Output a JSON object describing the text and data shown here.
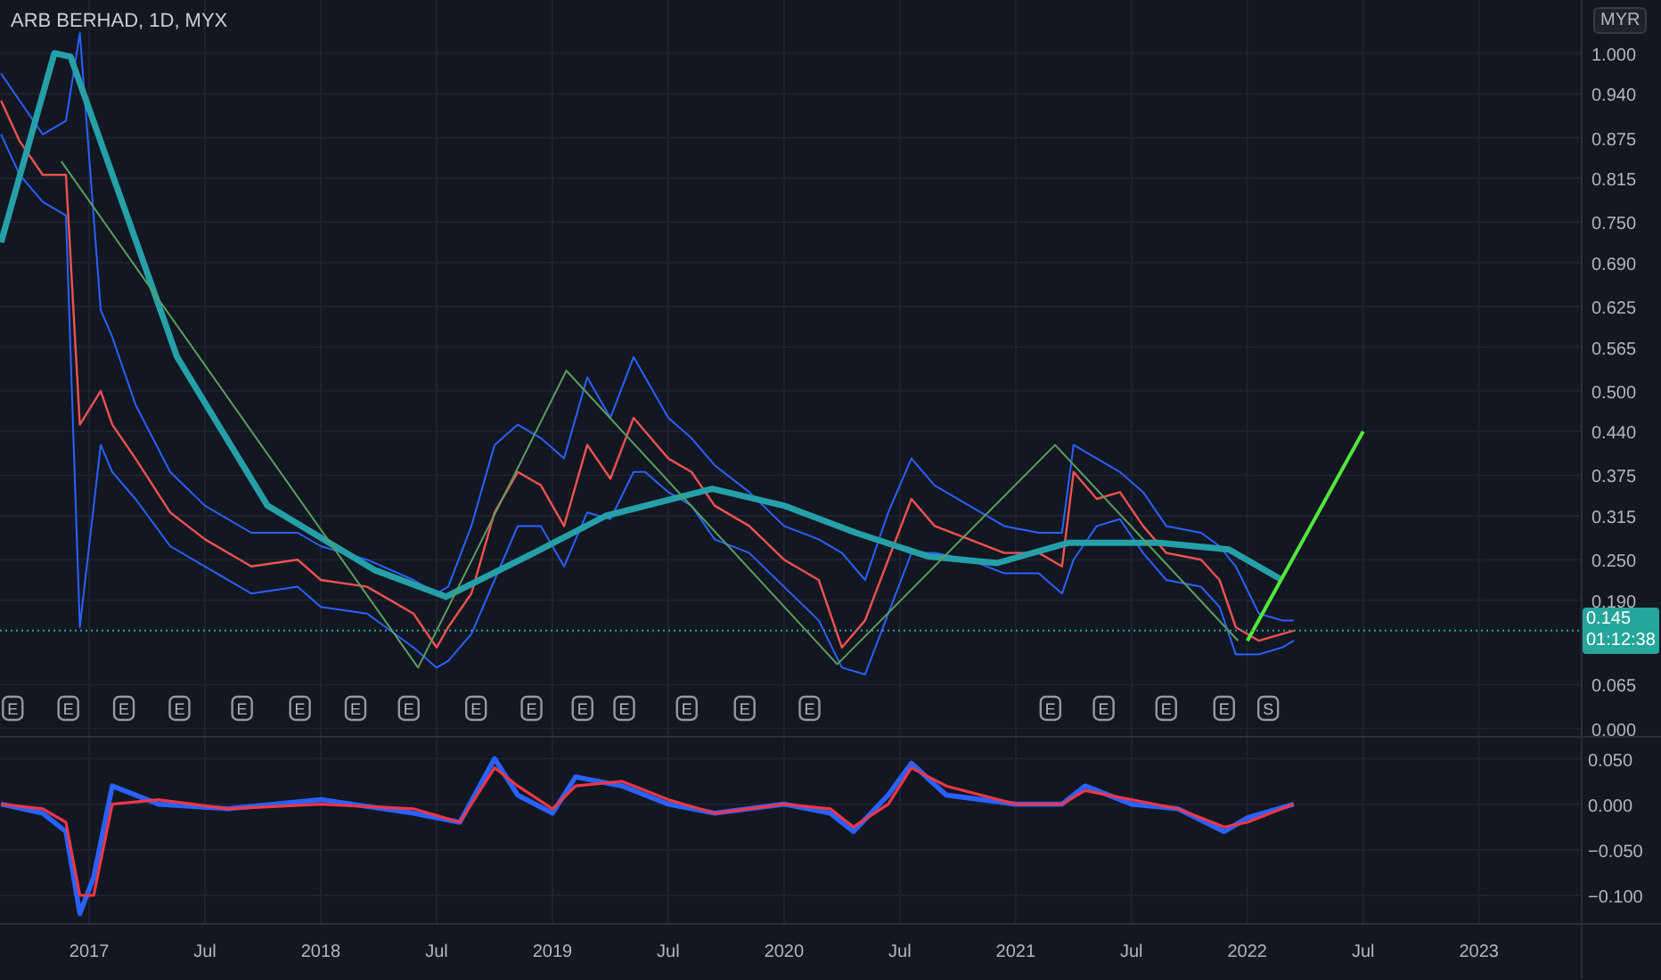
{
  "symbol": {
    "title": "ARB BERHAD, 1D, MYX",
    "currency": "MYR"
  },
  "price_chart": {
    "chart_data": {
      "type": "line",
      "grid": true,
      "xlim": [
        2016.615,
        2023.786
      ],
      "ylim": [
        -0.011,
        1.079
      ],
      "yticks": [
        {
          "value": 0,
          "label": "0.000"
        },
        {
          "value": 0.065,
          "label": "0.065"
        },
        {
          "value": 0.19,
          "label": "0.190"
        },
        {
          "value": 0.25,
          "label": "0.250"
        },
        {
          "value": 0.315,
          "label": "0.315"
        },
        {
          "value": 0.375,
          "label": "0.375"
        },
        {
          "value": 0.44,
          "label": "0.440"
        },
        {
          "value": 0.5,
          "label": "0.500"
        },
        {
          "value": 0.565,
          "label": "0.565"
        },
        {
          "value": 0.625,
          "label": "0.625"
        },
        {
          "value": 0.69,
          "label": "0.690"
        },
        {
          "value": 0.75,
          "label": "0.750"
        },
        {
          "value": 0.815,
          "label": "0.815"
        },
        {
          "value": 0.875,
          "label": "0.875"
        },
        {
          "value": 0.94,
          "label": "0.940"
        },
        {
          "value": 1,
          "label": "1.000"
        }
      ],
      "series": [
        {
          "color": "#2962ff",
          "x": [
            2016.62,
            2016.7,
            2016.8,
            2016.9,
            2016.96,
            2017.05,
            2017.1,
            2017.2,
            2017.35,
            2017.5,
            2017.7,
            2017.9,
            2018.0,
            2018.2,
            2018.4,
            2018.5,
            2018.55,
            2018.65,
            2018.75,
            2018.85,
            2018.95,
            2019.05,
            2019.15,
            2019.25,
            2019.35,
            2019.4,
            2019.5,
            2019.6,
            2019.7,
            2019.85,
            2020.0,
            2020.15,
            2020.25,
            2020.35,
            2020.45,
            2020.55,
            2020.65,
            2020.8,
            2020.95,
            2021.1,
            2021.2,
            2021.25,
            2021.35,
            2021.45,
            2021.55,
            2021.65,
            2021.8,
            2021.88,
            2021.95,
            2022.05,
            2022.15,
            2022.2
          ],
          "values": [
            0.97,
            0.93,
            0.88,
            0.9,
            1.03,
            0.62,
            0.58,
            0.48,
            0.38,
            0.33,
            0.29,
            0.29,
            0.27,
            0.25,
            0.22,
            0.2,
            0.21,
            0.3,
            0.42,
            0.45,
            0.43,
            0.4,
            0.52,
            0.46,
            0.55,
            0.52,
            0.46,
            0.43,
            0.39,
            0.35,
            0.3,
            0.28,
            0.26,
            0.22,
            0.32,
            0.4,
            0.36,
            0.33,
            0.3,
            0.29,
            0.29,
            0.42,
            0.4,
            0.38,
            0.35,
            0.3,
            0.29,
            0.27,
            0.24,
            0.17,
            0.16,
            0.16
          ]
        },
        {
          "color": "#2962ff",
          "x": [
            2016.62,
            2016.7,
            2016.8,
            2016.9,
            2016.96,
            2017.05,
            2017.1,
            2017.2,
            2017.35,
            2017.5,
            2017.7,
            2017.9,
            2018.0,
            2018.2,
            2018.4,
            2018.5,
            2018.55,
            2018.65,
            2018.75,
            2018.85,
            2018.95,
            2019.05,
            2019.15,
            2019.25,
            2019.35,
            2019.4,
            2019.5,
            2019.6,
            2019.7,
            2019.85,
            2020.0,
            2020.15,
            2020.25,
            2020.35,
            2020.45,
            2020.55,
            2020.65,
            2020.8,
            2020.95,
            2021.1,
            2021.2,
            2021.25,
            2021.35,
            2021.45,
            2021.55,
            2021.65,
            2021.8,
            2021.88,
            2021.95,
            2022.05,
            2022.15,
            2022.2
          ],
          "values": [
            0.88,
            0.82,
            0.78,
            0.76,
            0.15,
            0.42,
            0.38,
            0.34,
            0.27,
            0.24,
            0.2,
            0.21,
            0.18,
            0.17,
            0.12,
            0.09,
            0.1,
            0.14,
            0.22,
            0.3,
            0.3,
            0.24,
            0.32,
            0.31,
            0.38,
            0.38,
            0.35,
            0.33,
            0.28,
            0.26,
            0.21,
            0.16,
            0.09,
            0.08,
            0.17,
            0.26,
            0.26,
            0.25,
            0.23,
            0.23,
            0.2,
            0.25,
            0.3,
            0.31,
            0.26,
            0.22,
            0.21,
            0.18,
            0.11,
            0.11,
            0.12,
            0.13
          ]
        },
        {
          "color": "#ef5350",
          "x": [
            2016.62,
            2016.7,
            2016.8,
            2016.9,
            2016.96,
            2017.05,
            2017.1,
            2017.2,
            2017.35,
            2017.5,
            2017.7,
            2017.9,
            2018.0,
            2018.2,
            2018.4,
            2018.5,
            2018.55,
            2018.65,
            2018.75,
            2018.85,
            2018.95,
            2019.05,
            2019.15,
            2019.25,
            2019.35,
            2019.4,
            2019.5,
            2019.6,
            2019.7,
            2019.85,
            2020.0,
            2020.15,
            2020.25,
            2020.35,
            2020.45,
            2020.55,
            2020.65,
            2020.8,
            2020.95,
            2021.1,
            2021.2,
            2021.25,
            2021.35,
            2021.45,
            2021.55,
            2021.65,
            2021.8,
            2021.88,
            2021.95,
            2022.05,
            2022.15,
            2022.2
          ],
          "values": [
            0.93,
            0.87,
            0.82,
            0.82,
            0.45,
            0.5,
            0.45,
            0.4,
            0.32,
            0.28,
            0.24,
            0.25,
            0.22,
            0.21,
            0.17,
            0.12,
            0.15,
            0.2,
            0.32,
            0.38,
            0.36,
            0.3,
            0.42,
            0.37,
            0.46,
            0.44,
            0.4,
            0.38,
            0.33,
            0.3,
            0.25,
            0.22,
            0.12,
            0.16,
            0.25,
            0.34,
            0.3,
            0.28,
            0.26,
            0.26,
            0.24,
            0.38,
            0.34,
            0.35,
            0.3,
            0.26,
            0.25,
            0.22,
            0.15,
            0.13,
            0.14,
            0.145
          ]
        },
        {
          "color": "#26a0a8",
          "x": [
            2016.62,
            2016.85,
            2016.92,
            2017.38,
            2017.77,
            2018.23,
            2018.54,
            2018.92,
            2019.23,
            2019.69,
            2020.0,
            2020.31,
            2020.62,
            2020.92,
            2021.23,
            2021.62,
            2021.92,
            2022.15
          ],
          "values": [
            0.72,
            1.0,
            0.995,
            0.55,
            0.33,
            0.235,
            0.195,
            0.26,
            0.315,
            0.355,
            0.33,
            0.29,
            0.255,
            0.245,
            0.275,
            0.275,
            0.265,
            0.22
          ]
        },
        {
          "color": "#5a9e5c",
          "x": [
            2016.88,
            2018.42,
            2019.06,
            2020.23,
            2021.17,
            2021.96
          ],
          "values": [
            0.84,
            0.09,
            0.53,
            0.095,
            0.42,
            0.13
          ]
        },
        {
          "color": "#52e83a",
          "x": [
            2022.0,
            2022.5
          ],
          "values": [
            0.13,
            0.44
          ]
        },
        {
          "color": "#26a69a",
          "line_style": "dotted",
          "x": [
            2016.615,
            2023.44
          ],
          "values": [
            0.145,
            0.145
          ]
        }
      ],
      "annotations": [
        {
          "x": 2016.67,
          "y": 0.03,
          "text": "E"
        },
        {
          "x": 2016.91,
          "y": 0.03,
          "text": "E"
        },
        {
          "x": 2017.15,
          "y": 0.03,
          "text": "E"
        },
        {
          "x": 2017.39,
          "y": 0.03,
          "text": "E"
        },
        {
          "x": 2017.66,
          "y": 0.03,
          "text": "E"
        },
        {
          "x": 2017.91,
          "y": 0.03,
          "text": "E"
        },
        {
          "x": 2018.15,
          "y": 0.03,
          "text": "E"
        },
        {
          "x": 2018.38,
          "y": 0.03,
          "text": "E"
        },
        {
          "x": 2018.67,
          "y": 0.03,
          "text": "E"
        },
        {
          "x": 2018.91,
          "y": 0.03,
          "text": "E"
        },
        {
          "x": 2019.13,
          "y": 0.03,
          "text": "E"
        },
        {
          "x": 2019.31,
          "y": 0.03,
          "text": "E"
        },
        {
          "x": 2019.58,
          "y": 0.03,
          "text": "E"
        },
        {
          "x": 2019.83,
          "y": 0.03,
          "text": "E"
        },
        {
          "x": 2020.11,
          "y": 0.03,
          "text": "E"
        },
        {
          "x": 2021.15,
          "y": 0.03,
          "text": "E"
        },
        {
          "x": 2021.38,
          "y": 0.03,
          "text": "E"
        },
        {
          "x": 2021.65,
          "y": 0.03,
          "text": "E"
        },
        {
          "x": 2021.9,
          "y": 0.03,
          "text": "E"
        },
        {
          "x": 2022.09,
          "y": 0.03,
          "text": "S"
        }
      ]
    },
    "last_price": {
      "value": "0.145",
      "countdown": "01:12:38"
    }
  },
  "oscillator": {
    "chart_data": {
      "type": "line",
      "grid": true,
      "xlim": [
        2016.615,
        2023.786
      ],
      "ylim": [
        -0.193,
        0.073
      ],
      "yticks": [
        {
          "value": 0.05,
          "label": "0.050"
        },
        {
          "value": 0,
          "label": "0.000"
        },
        {
          "value": -0.05,
          "label": "−0.050"
        },
        {
          "value": -0.1,
          "label": "−0.100"
        }
      ],
      "xticks": [
        {
          "value": 2017,
          "label": "2017"
        },
        {
          "value": 2017.5,
          "label": "Jul"
        },
        {
          "value": 2018,
          "label": "2018"
        },
        {
          "value": 2018.5,
          "label": "Jul"
        },
        {
          "value": 2019,
          "label": "2019"
        },
        {
          "value": 2019.5,
          "label": "Jul"
        },
        {
          "value": 2020,
          "label": "2020"
        },
        {
          "value": 2020.5,
          "label": "Jul"
        },
        {
          "value": 2021,
          "label": "2021"
        },
        {
          "value": 2021.5,
          "label": "Jul"
        },
        {
          "value": 2022,
          "label": "2022"
        },
        {
          "value": 2022.5,
          "label": "Jul"
        },
        {
          "value": 2023,
          "label": "2023"
        }
      ],
      "x": [
        2016.62,
        2016.8,
        2016.9,
        2016.96,
        2017.02,
        2017.1,
        2017.3,
        2017.6,
        2018.0,
        2018.4,
        2018.6,
        2018.75,
        2018.85,
        2019.0,
        2019.1,
        2019.3,
        2019.5,
        2019.7,
        2020.0,
        2020.2,
        2020.3,
        2020.45,
        2020.55,
        2020.7,
        2021.0,
        2021.2,
        2021.3,
        2021.5,
        2021.7,
        2021.9,
        2022.0,
        2022.2
      ],
      "series": [
        {
          "color": "#2962ff",
          "values": [
            0.0,
            -0.01,
            -0.03,
            -0.12,
            -0.08,
            0.02,
            0.0,
            -0.005,
            0.005,
            -0.01,
            -0.02,
            0.05,
            0.01,
            -0.01,
            0.03,
            0.02,
            0.0,
            -0.01,
            0.0,
            -0.01,
            -0.03,
            0.01,
            0.045,
            0.01,
            0.0,
            0.0,
            0.02,
            0.0,
            -0.005,
            -0.03,
            -0.015,
            0.0
          ]
        },
        {
          "color": "#f23645",
          "values": [
            0.0,
            -0.005,
            -0.02,
            -0.1,
            -0.1,
            0.0,
            0.005,
            -0.005,
            0.0,
            -0.005,
            -0.02,
            0.04,
            0.02,
            -0.005,
            0.02,
            0.025,
            0.005,
            -0.01,
            0.0,
            -0.005,
            -0.025,
            0.0,
            0.04,
            0.02,
            0.0,
            0.0,
            0.015,
            0.005,
            -0.005,
            -0.025,
            -0.02,
            0.0
          ]
        }
      ]
    }
  }
}
